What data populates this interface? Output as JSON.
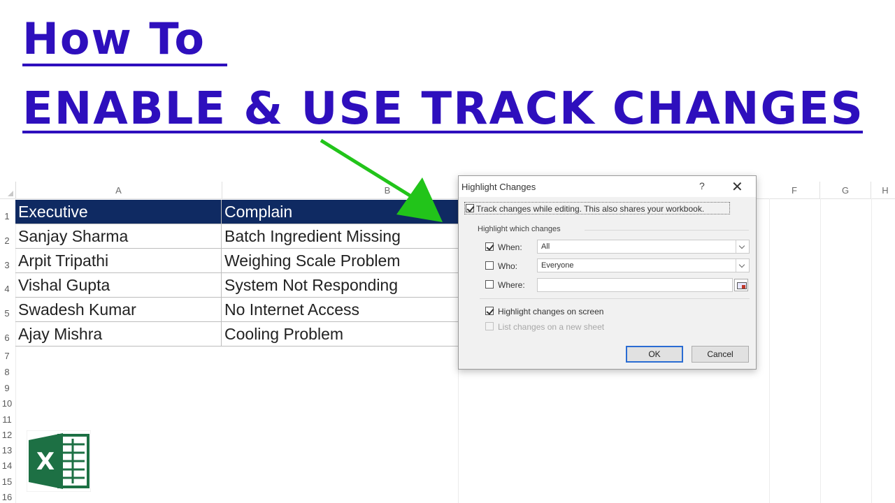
{
  "title": {
    "line1": "How To ",
    "line2": "ENABLE & USE TRACK CHANGES",
    "color": "#2e0fbd"
  },
  "sheet": {
    "columns": [
      "A",
      "B",
      "F",
      "G",
      "H"
    ],
    "rows": [
      "1",
      "2",
      "3",
      "4",
      "5",
      "6",
      "7",
      "8",
      "9",
      "10",
      "11",
      "12",
      "13",
      "14",
      "15",
      "16"
    ],
    "header": {
      "executive": "Executive",
      "complain": "Complain"
    },
    "data": [
      {
        "executive": "Sanjay Sharma",
        "complain": "Batch Ingredient Missing"
      },
      {
        "executive": "Arpit Tripathi",
        "complain": "Weighing Scale Problem"
      },
      {
        "executive": "Vishal Gupta",
        "complain": "System Not Responding"
      },
      {
        "executive": "Swadesh Kumar",
        "complain": "No Internet Access"
      },
      {
        "executive": "Ajay Mishra",
        "complain": "Cooling Problem"
      }
    ],
    "header_color": "#0f2a62"
  },
  "dialog": {
    "title": "Highlight Changes",
    "help": "?",
    "close": "✕",
    "track_label": "Track changes while editing. This also shares your workbook.",
    "track_checked": true,
    "group_label": "Highlight which changes",
    "when_label": "When:",
    "when_checked": true,
    "when_value": "All",
    "who_label": "Who:",
    "who_checked": false,
    "who_value": "Everyone",
    "where_label": "Where:",
    "where_checked": false,
    "where_value": "",
    "onscreen_label": "Highlight changes on screen",
    "onscreen_checked": true,
    "newsheet_label": "List changes on a new sheet",
    "newsheet_checked": false,
    "ok_label": "OK",
    "cancel_label": "Cancel"
  },
  "arrow_color": "#22c41a",
  "logo": {
    "letter": "X",
    "color": "#1d7044"
  }
}
